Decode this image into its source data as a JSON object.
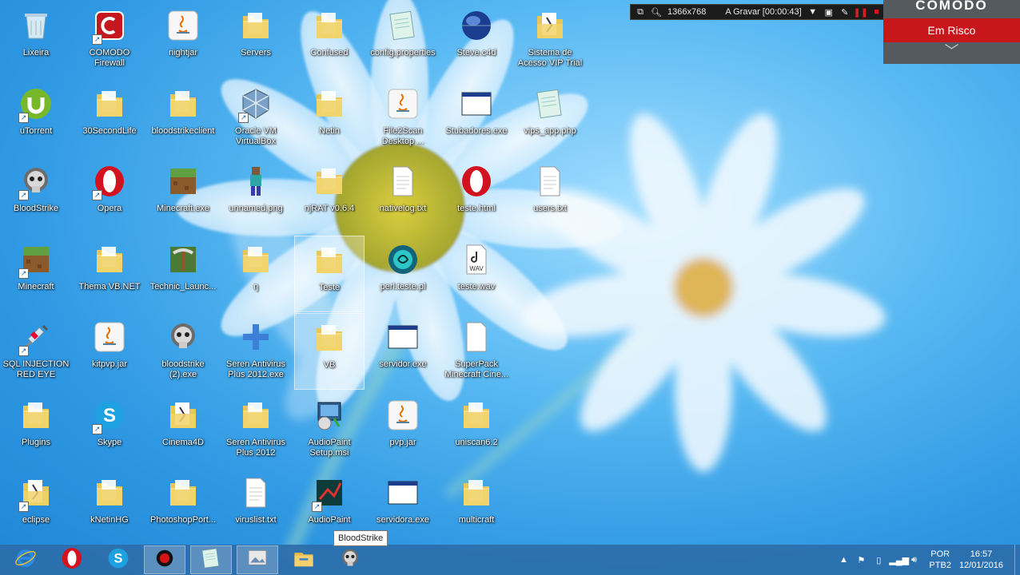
{
  "recorder": {
    "resolution": "1366x768",
    "status": "A Gravar [00:00:43]"
  },
  "comodo": {
    "brand": "COMODO",
    "status": "Em Risco"
  },
  "tooltip": "BloodStrike",
  "desktop": {
    "icons": [
      {
        "label": "Lixeira",
        "icon": "recycle-bin-icon",
        "shortcut": false
      },
      {
        "label": "uTorrent",
        "icon": "utorrent-icon",
        "shortcut": true
      },
      {
        "label": "BloodStrike",
        "icon": "skull-icon",
        "shortcut": true
      },
      {
        "label": "Minecraft",
        "icon": "grass-block-icon",
        "shortcut": true
      },
      {
        "label": "SQL INJECTION RED EYE",
        "icon": "syringe-icon",
        "shortcut": true
      },
      {
        "label": "Plugins",
        "icon": "folder-icon",
        "shortcut": false
      },
      {
        "label": "eclipse",
        "icon": "folder-doc-icon",
        "shortcut": true
      },
      {
        "label": "COMODO Firewall",
        "icon": "comodo-icon",
        "shortcut": true
      },
      {
        "label": "30SecondLife",
        "icon": "folder-icon",
        "shortcut": false
      },
      {
        "label": "Opera",
        "icon": "opera-icon",
        "shortcut": true
      },
      {
        "label": "Thema VB.NET",
        "icon": "folder-icon",
        "shortcut": false
      },
      {
        "label": "kitpvp.jar",
        "icon": "java-icon",
        "shortcut": false
      },
      {
        "label": "Skype",
        "icon": "skype-icon",
        "shortcut": true
      },
      {
        "label": "kNetinHG",
        "icon": "folder-icon",
        "shortcut": false
      },
      {
        "label": "nightjar",
        "icon": "java-icon",
        "shortcut": false
      },
      {
        "label": "bloodstrikeclient",
        "icon": "folder-icon",
        "shortcut": false
      },
      {
        "label": "Minecraft.exe",
        "icon": "grass-block-icon",
        "shortcut": false
      },
      {
        "label": "Technic_Launc...",
        "icon": "pickaxe-icon",
        "shortcut": false
      },
      {
        "label": "bloodstrike (2).exe",
        "icon": "skull-icon",
        "shortcut": false
      },
      {
        "label": "Cinema4D",
        "icon": "folder-doc-icon",
        "shortcut": false
      },
      {
        "label": "PhotoshopPort...",
        "icon": "folder-icon",
        "shortcut": false
      },
      {
        "label": "Servers",
        "icon": "folder-icon",
        "shortcut": false
      },
      {
        "label": "Oracle VM VirtualBox",
        "icon": "virtualbox-icon",
        "shortcut": true
      },
      {
        "label": "unnamed.png",
        "icon": "image-icon",
        "shortcut": false
      },
      {
        "label": "ŋ",
        "icon": "folder-icon",
        "shortcut": false
      },
      {
        "label": "Seren Antivirus Plus 2012.exe",
        "icon": "blue-plus-icon",
        "shortcut": false
      },
      {
        "label": "Seren Antivirus Plus 2012",
        "icon": "folder-icon",
        "shortcut": false
      },
      {
        "label": "viruslist.txt",
        "icon": "text-file-icon",
        "shortcut": false
      },
      {
        "label": "Confused",
        "icon": "folder-icon",
        "shortcut": false
      },
      {
        "label": "Netin",
        "icon": "folder-icon",
        "shortcut": false
      },
      {
        "label": "njRAT v0.6.4",
        "icon": "folder-icon",
        "shortcut": false
      },
      {
        "label": "Teste",
        "icon": "folder-icon",
        "shortcut": false
      },
      {
        "label": "VB",
        "icon": "folder-icon",
        "shortcut": false
      },
      {
        "label": "AudioPaint Setup.msi",
        "icon": "installer-icon",
        "shortcut": false
      },
      {
        "label": "AudioPaint",
        "icon": "audiopaint-icon",
        "shortcut": true
      },
      {
        "label": "config.properties",
        "icon": "notepad-icon",
        "shortcut": false
      },
      {
        "label": "File2Scan Desktop ...",
        "icon": "java-icon",
        "shortcut": false
      },
      {
        "label": "nativelog.txt",
        "icon": "text-file-icon",
        "shortcut": false
      },
      {
        "label": "perl.teste.pl",
        "icon": "perl-icon",
        "shortcut": false
      },
      {
        "label": "servidor.exe",
        "icon": "window-app-icon",
        "shortcut": false
      },
      {
        "label": "pvp.jar",
        "icon": "java-icon",
        "shortcut": false
      },
      {
        "label": "servidora.exe",
        "icon": "window-app-icon",
        "shortcut": false
      },
      {
        "label": "Steve.c4d",
        "icon": "globe-icon",
        "shortcut": false
      },
      {
        "label": "Stubadores.exe",
        "icon": "window-app-icon",
        "shortcut": false
      },
      {
        "label": "teste.html",
        "icon": "opera-icon",
        "shortcut": false
      },
      {
        "label": "teste.wav",
        "icon": "wav-file-icon",
        "shortcut": false
      },
      {
        "label": "SuperPack Minecraft Cine...",
        "icon": "blank-file-icon",
        "shortcut": false
      },
      {
        "label": "uniscan6.2",
        "icon": "folder-icon",
        "shortcut": false
      },
      {
        "label": "multicraft",
        "icon": "folder-icon",
        "shortcut": false
      },
      {
        "label": "Sistema de Acesso VIP Trial",
        "icon": "folder-doc-icon",
        "shortcut": false
      },
      {
        "label": "vips_app.php",
        "icon": "notepad-icon",
        "shortcut": false
      },
      {
        "label": "users.txt",
        "icon": "text-file-icon",
        "shortcut": false
      }
    ]
  },
  "taskbar": {
    "apps": [
      {
        "name": "internet-explorer",
        "icon": "ie-icon"
      },
      {
        "name": "opera",
        "icon": "opera-icon"
      },
      {
        "name": "skype",
        "icon": "skype-icon"
      },
      {
        "name": "recorder",
        "icon": "record-icon"
      },
      {
        "name": "notepad",
        "icon": "notepad-icon"
      },
      {
        "name": "photos",
        "icon": "photos-icon"
      },
      {
        "name": "file-explorer",
        "icon": "explorer-icon"
      },
      {
        "name": "bloodstrike",
        "icon": "skull-icon"
      }
    ],
    "language": "POR",
    "keyboard": "PTB2",
    "time": "16:57",
    "date": "12/01/2016"
  }
}
